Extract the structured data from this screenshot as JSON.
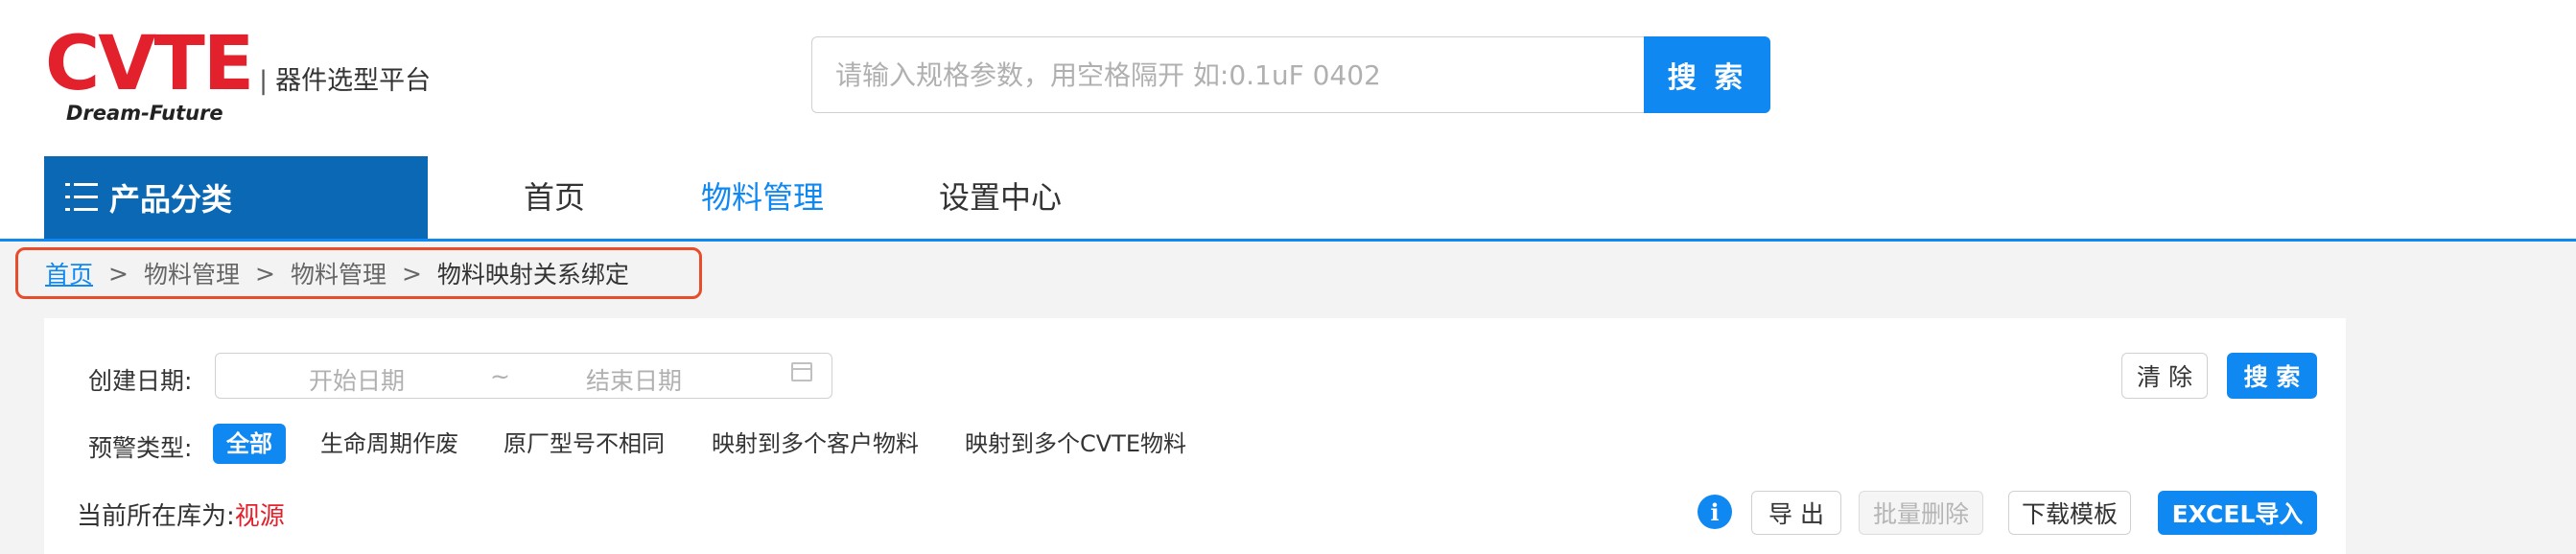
{
  "brand": {
    "logo_text": "CVTE",
    "tagline": "Dream-Future",
    "site_name": "器件选型平台",
    "brand_color": "#e3212c"
  },
  "search": {
    "placeholder": "请输入规格参数，用空格隔开 如:0.1uF 0402",
    "value": "",
    "button_label": "搜 索"
  },
  "nav": {
    "category_label": "产品分类",
    "category_icon": "list-icon",
    "links": [
      "首页",
      "物料管理",
      "设置中心"
    ],
    "active": "物料管理",
    "accent_color": "#1088f2"
  },
  "breadcrumb": {
    "items": [
      "首页",
      "物料管理",
      "物料管理",
      "物料映射关系绑定"
    ],
    "separator": ">"
  },
  "filters": {
    "date_label": "创建日期:",
    "start_placeholder": "开始日期",
    "range_separator": "~",
    "end_placeholder": "结束日期",
    "date_icon": "calendar-icon",
    "clear_label": "清 除",
    "search_label": "搜 索",
    "warning_label": "预警类型:",
    "warning_types": [
      "全部",
      "生命周期作废",
      "原厂型号不相同",
      "映射到多个客户物料",
      "映射到多个CVTE物料"
    ],
    "warning_active": "全部"
  },
  "toolbar": {
    "library_label": "当前所在库为:",
    "library_value": "视源",
    "info_icon": "info-icon",
    "export_label": "导 出",
    "batch_delete_label": "批量删除",
    "download_template_label": "下载模板",
    "excel_import_label": "EXCEL导入"
  }
}
